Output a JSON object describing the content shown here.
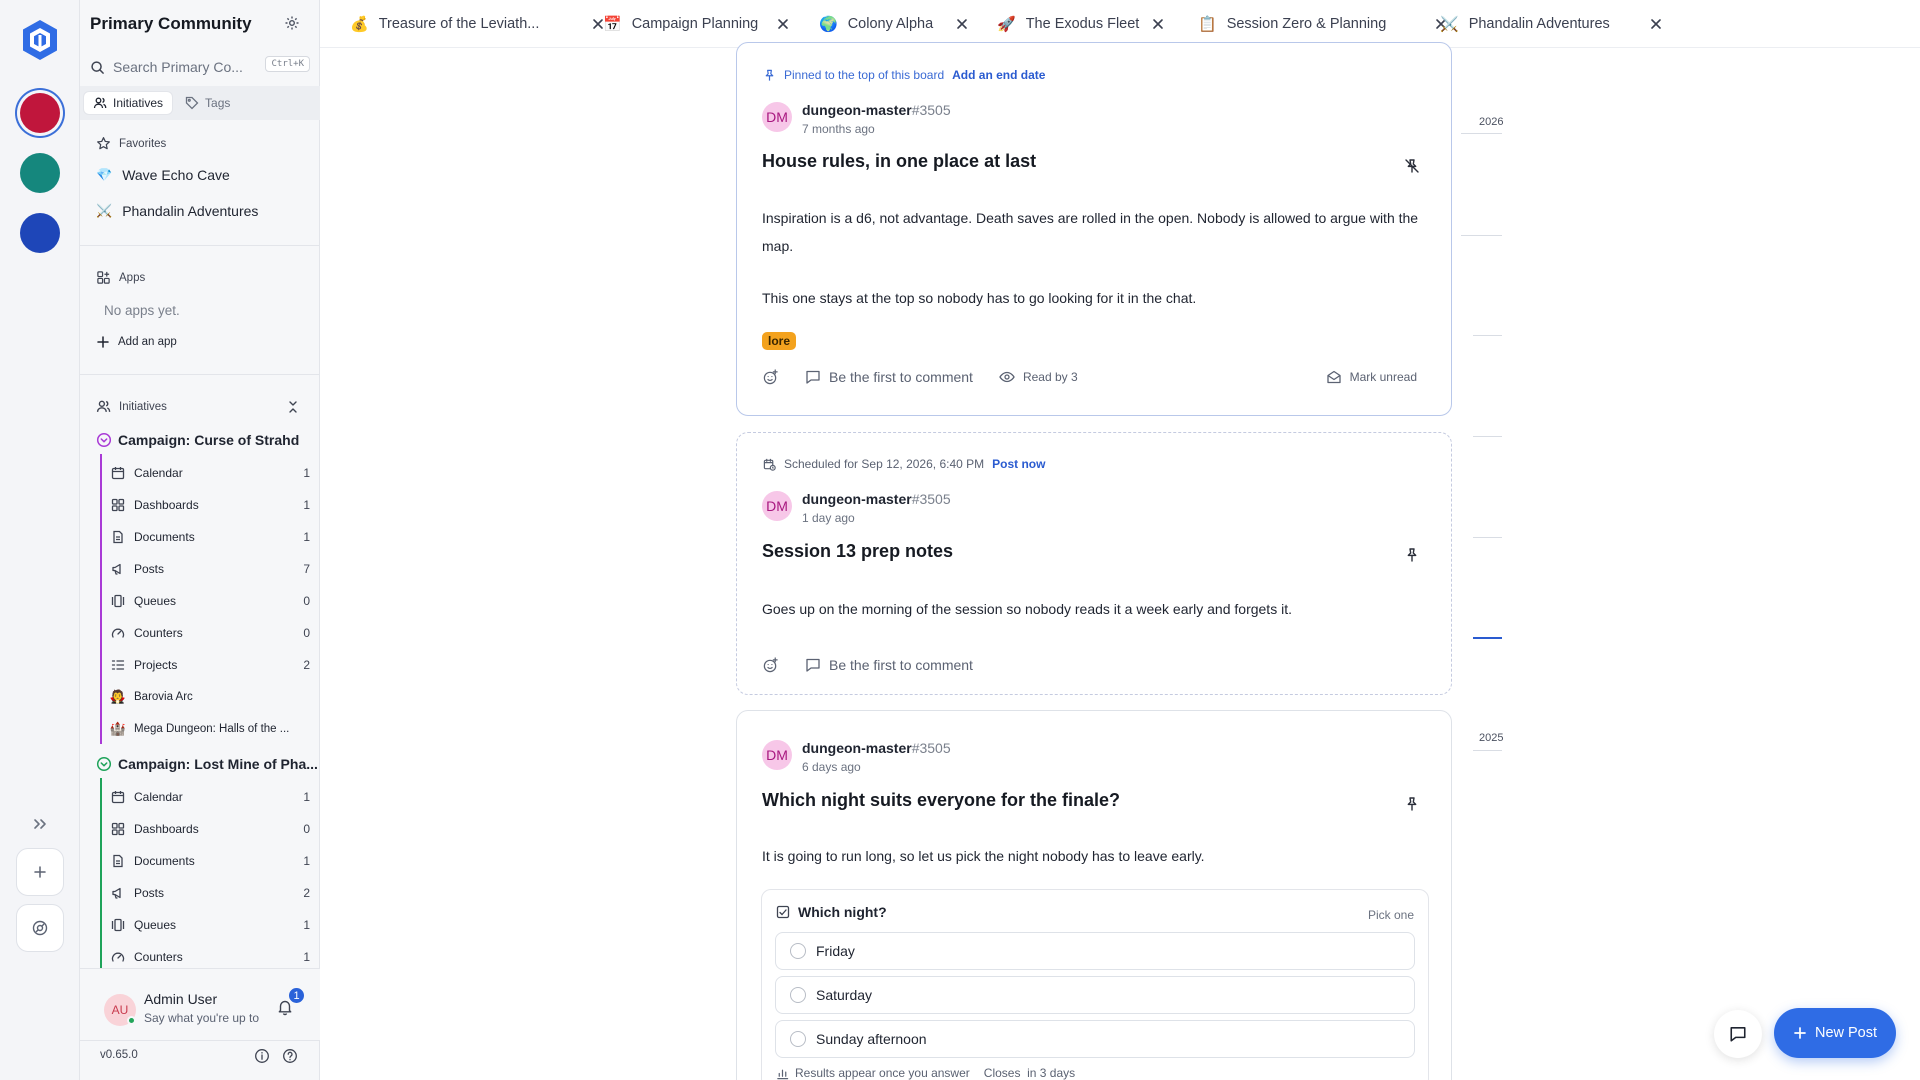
{
  "rail": {
    "servers": [
      {
        "name": "server-1",
        "color": "#c0163c"
      },
      {
        "name": "server-2",
        "color": "#15877d"
      },
      {
        "name": "server-3",
        "color": "#1e46b8"
      }
    ]
  },
  "sidebar": {
    "title": "Primary Community",
    "search_placeholder": "Search Primary Co...",
    "search_shortcut": "Ctrl+K",
    "tabs": [
      {
        "label": "Initiatives"
      },
      {
        "label": "Tags"
      }
    ],
    "favorites_label": "Favorites",
    "favorites": [
      {
        "label": "Wave Echo Cave",
        "icon": "💎"
      },
      {
        "label": "Phandalin Adventures",
        "icon": "⚔️"
      }
    ],
    "apps_label": "Apps",
    "no_apps": "No apps yet.",
    "add_app": "Add an app",
    "initiatives_label": "Initiatives",
    "groups": [
      {
        "label": "Campaign: Curse of Strahd",
        "color": "#a93ad6",
        "items": [
          {
            "label": "Calendar",
            "count": "1"
          },
          {
            "label": "Dashboards",
            "count": "1"
          },
          {
            "label": "Documents",
            "count": "1"
          },
          {
            "label": "Posts",
            "count": "7"
          },
          {
            "label": "Queues",
            "count": "0"
          },
          {
            "label": "Counters",
            "count": "0"
          },
          {
            "label": "Projects",
            "count": "2"
          }
        ],
        "sub_items": [
          {
            "label": "Barovia Arc",
            "icon": "🧛"
          },
          {
            "label": "Mega Dungeon: Halls of the ...",
            "icon": "🏰"
          }
        ]
      },
      {
        "label": "Campaign: Lost Mine of Pha...",
        "color": "#1ea35a",
        "items": [
          {
            "label": "Calendar",
            "count": "1"
          },
          {
            "label": "Dashboards",
            "count": "0"
          },
          {
            "label": "Documents",
            "count": "1"
          },
          {
            "label": "Posts",
            "count": "2"
          },
          {
            "label": "Queues",
            "count": "1"
          },
          {
            "label": "Counters",
            "count": "1"
          }
        ]
      }
    ],
    "user": {
      "initials": "AU",
      "name": "Admin User",
      "status": "Say what you're up to",
      "notifications": "1"
    },
    "version": "v0.65.0"
  },
  "tabs": [
    {
      "icon": "💰",
      "label": "Treasure of the Leviath..."
    },
    {
      "icon": "📅",
      "label": "Campaign Planning"
    },
    {
      "icon": "🌍",
      "label": "Colony Alpha"
    },
    {
      "icon": "🚀",
      "label": "The Exodus Fleet"
    },
    {
      "icon": "📋",
      "label": "Session Zero & Planning"
    },
    {
      "icon": "⚔️",
      "label": "Phandalin Adventures"
    }
  ],
  "posts": [
    {
      "banner": "Pinned to the top of this board",
      "banner_action": "Add an end date",
      "author_initials": "DM",
      "author": "dungeon-master",
      "discriminator": "#3505",
      "time": "7 months ago",
      "title": "House rules, in one place at last",
      "body": [
        "Inspiration is a d6, not advantage. Death saves are rolled in the open. Nobody is allowed to argue with the map.",
        "This one stays at the top so nobody has to go looking for it in the chat."
      ],
      "tag": "lore",
      "tag_color": "#f3a21e",
      "comment": "Be the first to comment",
      "read_by": "Read by 3",
      "mark_unread": "Mark unread"
    },
    {
      "banner": "Scheduled for Sep 12, 2026, 6:40 PM",
      "banner_action": "Post now",
      "author_initials": "DM",
      "author": "dungeon-master",
      "discriminator": "#3505",
      "time": "1 day ago",
      "title": "Session 13 prep notes",
      "body": [
        "Goes up on the morning of the session so nobody reads it a week early and forgets it."
      ],
      "comment": "Be the first to comment"
    },
    {
      "author_initials": "DM",
      "author": "dungeon-master",
      "discriminator": "#3505",
      "time": "6 days ago",
      "title": "Which night suits everyone for the finale?",
      "body": [
        "It is going to run long, so let us pick the night nobody has to leave early."
      ],
      "poll": {
        "question": "Which night?",
        "hint": "Pick one",
        "options": [
          "Friday",
          "Saturday",
          "Sunday afternoon"
        ],
        "results_note": "Results appear once you answer",
        "closes": "Closes  in 3 days"
      }
    }
  ],
  "timeline": {
    "years": [
      "2026",
      "2025"
    ]
  },
  "new_post": "New Post"
}
